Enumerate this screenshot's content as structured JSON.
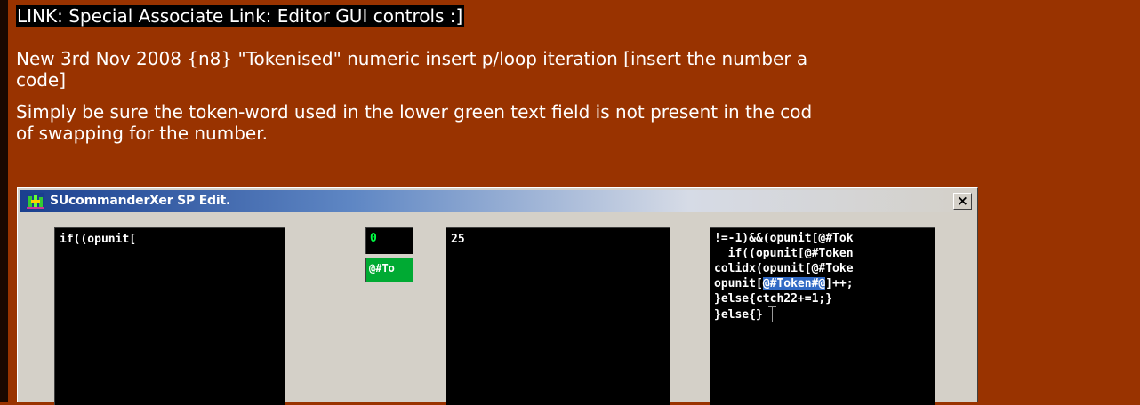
{
  "link": {
    "label": "LINK: Special Associate Link: Editor GUI controls :]"
  },
  "paragraphs": {
    "p1_line1": "New 3rd Nov 2008 {n8} \"Tokenised\" numeric insert p/loop iteration [insert the number a",
    "p1_line2": "code]",
    "p2_line1": "Simply be sure the token-word used in the lower green text field is not present in the cod",
    "p2_line2": "of swapping for the number."
  },
  "window": {
    "title": "SUcommanderXer SP Edit.",
    "close_label": "×",
    "app_icon": "sucommander-app-icon",
    "field_left": "if((opunit[",
    "field_start_number": "0",
    "field_token": "@#To",
    "field_middle": "25",
    "code_lines": [
      "!=-1)&&(opunit[@#Tok",
      "  if((opunit[@#Token",
      "colidx(opunit[@#Toke",
      "opunit[",
      "]++;",
      "}else{ctch22+=1;}",
      "}else{}"
    ],
    "code_selected": "@#Token#@"
  },
  "colors": {
    "page_background": "#993300",
    "text": "#ffffff",
    "field_background": "#000000",
    "token_field_background": "#00aa33",
    "number_text": "#00ff44",
    "selection": "#316ac5",
    "title_bar": "#1a3f8e"
  }
}
